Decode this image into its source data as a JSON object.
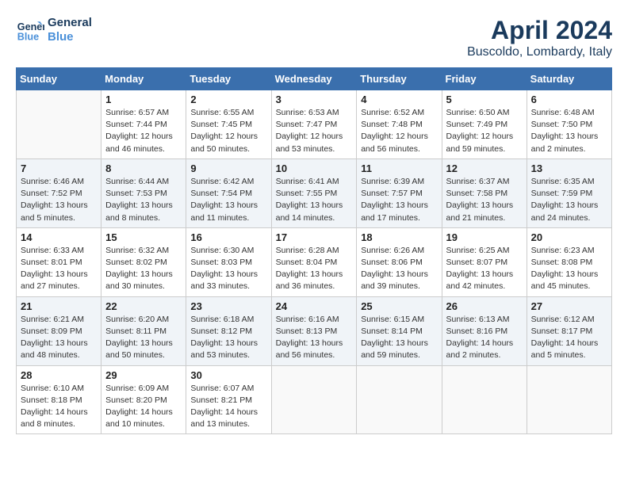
{
  "logo": {
    "line1": "General",
    "line2": "Blue"
  },
  "title": "April 2024",
  "location": "Buscoldo, Lombardy, Italy",
  "weekdays": [
    "Sunday",
    "Monday",
    "Tuesday",
    "Wednesday",
    "Thursday",
    "Friday",
    "Saturday"
  ],
  "weeks": [
    [
      {
        "day": "",
        "sunrise": "",
        "sunset": "",
        "daylight": ""
      },
      {
        "day": "1",
        "sunrise": "Sunrise: 6:57 AM",
        "sunset": "Sunset: 7:44 PM",
        "daylight": "Daylight: 12 hours and 46 minutes."
      },
      {
        "day": "2",
        "sunrise": "Sunrise: 6:55 AM",
        "sunset": "Sunset: 7:45 PM",
        "daylight": "Daylight: 12 hours and 50 minutes."
      },
      {
        "day": "3",
        "sunrise": "Sunrise: 6:53 AM",
        "sunset": "Sunset: 7:47 PM",
        "daylight": "Daylight: 12 hours and 53 minutes."
      },
      {
        "day": "4",
        "sunrise": "Sunrise: 6:52 AM",
        "sunset": "Sunset: 7:48 PM",
        "daylight": "Daylight: 12 hours and 56 minutes."
      },
      {
        "day": "5",
        "sunrise": "Sunrise: 6:50 AM",
        "sunset": "Sunset: 7:49 PM",
        "daylight": "Daylight: 12 hours and 59 minutes."
      },
      {
        "day": "6",
        "sunrise": "Sunrise: 6:48 AM",
        "sunset": "Sunset: 7:50 PM",
        "daylight": "Daylight: 13 hours and 2 minutes."
      }
    ],
    [
      {
        "day": "7",
        "sunrise": "Sunrise: 6:46 AM",
        "sunset": "Sunset: 7:52 PM",
        "daylight": "Daylight: 13 hours and 5 minutes."
      },
      {
        "day": "8",
        "sunrise": "Sunrise: 6:44 AM",
        "sunset": "Sunset: 7:53 PM",
        "daylight": "Daylight: 13 hours and 8 minutes."
      },
      {
        "day": "9",
        "sunrise": "Sunrise: 6:42 AM",
        "sunset": "Sunset: 7:54 PM",
        "daylight": "Daylight: 13 hours and 11 minutes."
      },
      {
        "day": "10",
        "sunrise": "Sunrise: 6:41 AM",
        "sunset": "Sunset: 7:55 PM",
        "daylight": "Daylight: 13 hours and 14 minutes."
      },
      {
        "day": "11",
        "sunrise": "Sunrise: 6:39 AM",
        "sunset": "Sunset: 7:57 PM",
        "daylight": "Daylight: 13 hours and 17 minutes."
      },
      {
        "day": "12",
        "sunrise": "Sunrise: 6:37 AM",
        "sunset": "Sunset: 7:58 PM",
        "daylight": "Daylight: 13 hours and 21 minutes."
      },
      {
        "day": "13",
        "sunrise": "Sunrise: 6:35 AM",
        "sunset": "Sunset: 7:59 PM",
        "daylight": "Daylight: 13 hours and 24 minutes."
      }
    ],
    [
      {
        "day": "14",
        "sunrise": "Sunrise: 6:33 AM",
        "sunset": "Sunset: 8:01 PM",
        "daylight": "Daylight: 13 hours and 27 minutes."
      },
      {
        "day": "15",
        "sunrise": "Sunrise: 6:32 AM",
        "sunset": "Sunset: 8:02 PM",
        "daylight": "Daylight: 13 hours and 30 minutes."
      },
      {
        "day": "16",
        "sunrise": "Sunrise: 6:30 AM",
        "sunset": "Sunset: 8:03 PM",
        "daylight": "Daylight: 13 hours and 33 minutes."
      },
      {
        "day": "17",
        "sunrise": "Sunrise: 6:28 AM",
        "sunset": "Sunset: 8:04 PM",
        "daylight": "Daylight: 13 hours and 36 minutes."
      },
      {
        "day": "18",
        "sunrise": "Sunrise: 6:26 AM",
        "sunset": "Sunset: 8:06 PM",
        "daylight": "Daylight: 13 hours and 39 minutes."
      },
      {
        "day": "19",
        "sunrise": "Sunrise: 6:25 AM",
        "sunset": "Sunset: 8:07 PM",
        "daylight": "Daylight: 13 hours and 42 minutes."
      },
      {
        "day": "20",
        "sunrise": "Sunrise: 6:23 AM",
        "sunset": "Sunset: 8:08 PM",
        "daylight": "Daylight: 13 hours and 45 minutes."
      }
    ],
    [
      {
        "day": "21",
        "sunrise": "Sunrise: 6:21 AM",
        "sunset": "Sunset: 8:09 PM",
        "daylight": "Daylight: 13 hours and 48 minutes."
      },
      {
        "day": "22",
        "sunrise": "Sunrise: 6:20 AM",
        "sunset": "Sunset: 8:11 PM",
        "daylight": "Daylight: 13 hours and 50 minutes."
      },
      {
        "day": "23",
        "sunrise": "Sunrise: 6:18 AM",
        "sunset": "Sunset: 8:12 PM",
        "daylight": "Daylight: 13 hours and 53 minutes."
      },
      {
        "day": "24",
        "sunrise": "Sunrise: 6:16 AM",
        "sunset": "Sunset: 8:13 PM",
        "daylight": "Daylight: 13 hours and 56 minutes."
      },
      {
        "day": "25",
        "sunrise": "Sunrise: 6:15 AM",
        "sunset": "Sunset: 8:14 PM",
        "daylight": "Daylight: 13 hours and 59 minutes."
      },
      {
        "day": "26",
        "sunrise": "Sunrise: 6:13 AM",
        "sunset": "Sunset: 8:16 PM",
        "daylight": "Daylight: 14 hours and 2 minutes."
      },
      {
        "day": "27",
        "sunrise": "Sunrise: 6:12 AM",
        "sunset": "Sunset: 8:17 PM",
        "daylight": "Daylight: 14 hours and 5 minutes."
      }
    ],
    [
      {
        "day": "28",
        "sunrise": "Sunrise: 6:10 AM",
        "sunset": "Sunset: 8:18 PM",
        "daylight": "Daylight: 14 hours and 8 minutes."
      },
      {
        "day": "29",
        "sunrise": "Sunrise: 6:09 AM",
        "sunset": "Sunset: 8:20 PM",
        "daylight": "Daylight: 14 hours and 10 minutes."
      },
      {
        "day": "30",
        "sunrise": "Sunrise: 6:07 AM",
        "sunset": "Sunset: 8:21 PM",
        "daylight": "Daylight: 14 hours and 13 minutes."
      },
      {
        "day": "",
        "sunrise": "",
        "sunset": "",
        "daylight": ""
      },
      {
        "day": "",
        "sunrise": "",
        "sunset": "",
        "daylight": ""
      },
      {
        "day": "",
        "sunrise": "",
        "sunset": "",
        "daylight": ""
      },
      {
        "day": "",
        "sunrise": "",
        "sunset": "",
        "daylight": ""
      }
    ]
  ]
}
